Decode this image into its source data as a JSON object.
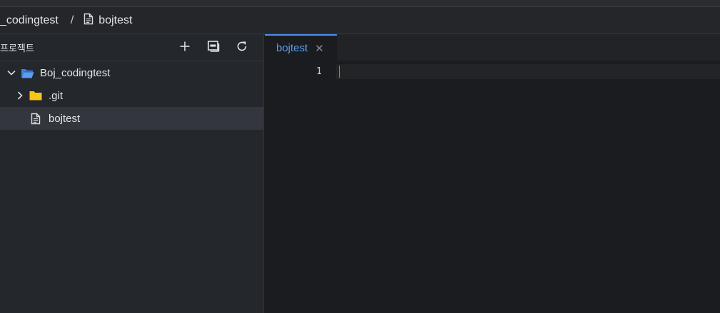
{
  "breadcrumb": {
    "project": "_codingtest",
    "separator": "/",
    "file": "bojtest"
  },
  "sidebar": {
    "title": "프로젝트",
    "actions": [
      {
        "name": "add-icon"
      },
      {
        "name": "collapse-all-icon"
      },
      {
        "name": "refresh-icon"
      }
    ],
    "tree": [
      {
        "label": "Boj_codingtest",
        "type": "folder-open",
        "expanded": true
      },
      {
        "label": ".git",
        "type": "folder",
        "expanded": false
      },
      {
        "label": "bojtest",
        "type": "file",
        "selected": true
      }
    ]
  },
  "editor": {
    "tabs": [
      {
        "label": "bojtest",
        "active": true
      }
    ],
    "lines": [
      {
        "number": "1",
        "text": ""
      }
    ]
  },
  "colors": {
    "accent": "#4b8df0",
    "folder_yellow": "#f5c518",
    "folder_blue": "#4b8df0"
  }
}
